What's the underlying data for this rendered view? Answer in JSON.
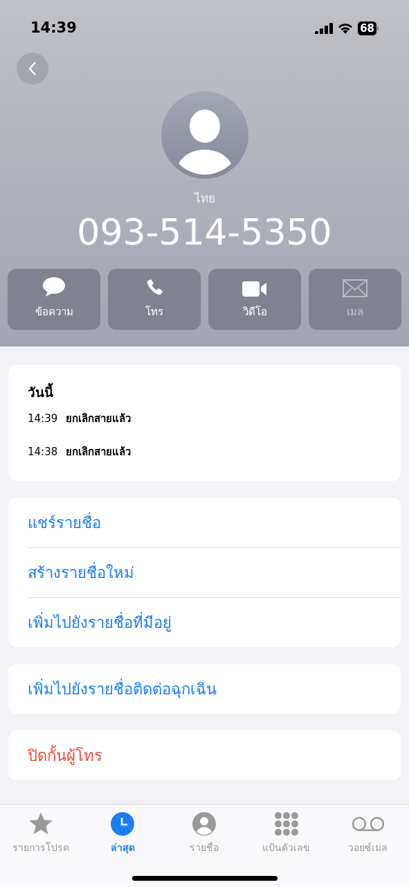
{
  "status_bar": {
    "time": "14:39",
    "battery": "68"
  },
  "contact": {
    "label": "ไทย",
    "number": "093-514-5350"
  },
  "actions": [
    {
      "kind": "message",
      "label": "ข้อความ",
      "disabled": false
    },
    {
      "kind": "call",
      "label": "โทร",
      "disabled": false
    },
    {
      "kind": "video",
      "label": "วิดีโอ",
      "disabled": false
    },
    {
      "kind": "mail",
      "label": "เมล",
      "disabled": true
    }
  ],
  "recents": {
    "title": "วันนี้",
    "calls": [
      {
        "time": "14:39",
        "status": "ยกเลิกสายแล้ว"
      },
      {
        "time": "14:38",
        "status": "ยกเลิกสายแล้ว"
      }
    ]
  },
  "option_groups": [
    [
      {
        "label": "แชร์รายชื่อ",
        "kind": "action"
      },
      {
        "label": "สร้างรายชื่อใหม่",
        "kind": "action"
      },
      {
        "label": "เพิ่มไปยังรายชื่อที่มีอยู่",
        "kind": "action"
      }
    ],
    [
      {
        "label": "เพิ่มไปยังรายชื่อติดต่อฉุกเฉิน",
        "kind": "action"
      }
    ],
    [
      {
        "label": "ปิดกั้นผู้โทร",
        "kind": "destructive"
      }
    ]
  ],
  "tab_bar": [
    {
      "kind": "favorites",
      "label": "รายการโปรด",
      "selected": false
    },
    {
      "kind": "recents",
      "label": "ล่าสุด",
      "selected": true
    },
    {
      "kind": "contacts",
      "label": "รายชื่อ",
      "selected": false
    },
    {
      "kind": "keypad",
      "label": "แป้นตัวเลข",
      "selected": false
    },
    {
      "kind": "voicemail",
      "label": "วอยซ์เมล",
      "selected": false
    }
  ]
}
